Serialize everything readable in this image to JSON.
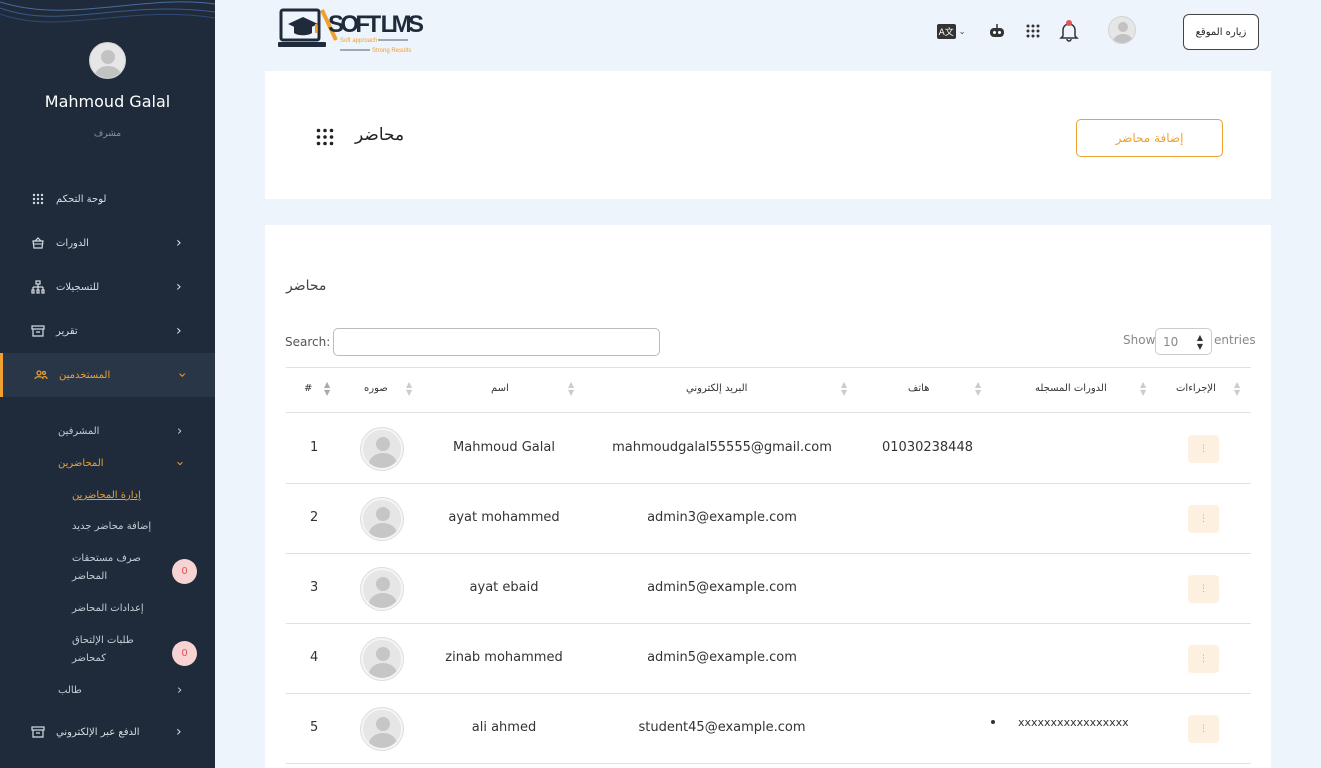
{
  "sidebar": {
    "user_name": "Mahmoud Galal",
    "user_role": "مشرف",
    "items": [
      {
        "label": "لوحة التحكم",
        "icon": "grid-icon"
      },
      {
        "label": "الدورات",
        "icon": "basket-icon"
      },
      {
        "label": "للتسجيلات",
        "icon": "sitemap-icon"
      },
      {
        "label": "تقرير",
        "icon": "archive-icon"
      },
      {
        "label": "المستخدمين",
        "icon": "users-icon"
      },
      {
        "label": "الدفع عبر الإلكتروني",
        "icon": "archive-icon"
      }
    ],
    "users_sub": {
      "supervisors": "المشرفين",
      "instructors": "المحاضرين",
      "manage_instructors": "إدارة المحاضرين",
      "add_instructor": "إضافة محاضر جديد",
      "payouts_line1": "صرف مستحقات",
      "payouts_line2": "المحاضر",
      "payouts_badge": "0",
      "instructor_settings": "إعدادات المحاضر",
      "join_requests_line1": "طلبات الإلتحاق",
      "join_requests_line2": "كمحاضر",
      "join_requests_badge": "0",
      "students": "طالب"
    }
  },
  "topbar": {
    "logo_text": "SOFT LMS",
    "logo_tag1": "Soft approach",
    "logo_tag2": "Strong Results",
    "language_label": "A文",
    "visit_site": "زياره الموقع"
  },
  "header": {
    "title": "محاضر",
    "add_button": "إضافة محاضر"
  },
  "table": {
    "title": "محاضر",
    "search_label": "Search:",
    "search_value": "",
    "show_label": "Show",
    "show_value": "10",
    "entries_label": "entries",
    "columns": {
      "num": "#",
      "photo": "صوره",
      "name": "اسم",
      "email": "البريد إلكتروني",
      "phone": "هاتف",
      "courses": "الدورات المسجله",
      "actions": "الإجراءات"
    },
    "rows": [
      {
        "num": "1",
        "name": "Mahmoud Galal",
        "email": "mahmoudgalal55555@gmail.com",
        "phone": "01030238448",
        "courses": ""
      },
      {
        "num": "2",
        "name": "ayat mohammed",
        "email": "admin3@example.com",
        "phone": "",
        "courses": ""
      },
      {
        "num": "3",
        "name": "ayat ebaid",
        "email": "admin5@example.com",
        "phone": "",
        "courses": ""
      },
      {
        "num": "4",
        "name": "zinab mohammed",
        "email": "admin5@example.com",
        "phone": "",
        "courses": ""
      },
      {
        "num": "5",
        "name": "ali ahmed",
        "email": "student45@example.com",
        "phone": "",
        "courses": "xxxxxxxxxxxxxxxxx"
      }
    ],
    "action_glyph": "⋮"
  },
  "colors": {
    "sidebar_bg": "#1f2b3a",
    "accent": "#f0a030",
    "page_bg": "#eef4fb"
  }
}
